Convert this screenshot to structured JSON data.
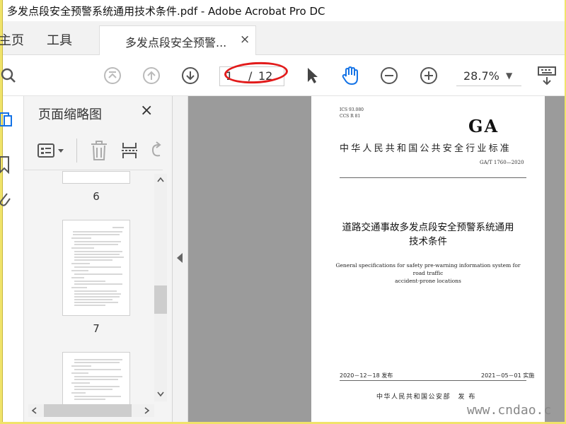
{
  "window": {
    "title": "多发点段安全预警系统通用技术条件.pdf - Adobe Acrobat Pro DC"
  },
  "menu": {
    "home": "主页",
    "tools": "工具"
  },
  "tab": {
    "label": "多发点段安全预警...",
    "close": "×"
  },
  "toolbar": {
    "page_current": "1",
    "page_sep": "/",
    "page_total": "12",
    "zoom": "28.7%",
    "zoom_arrow": "▼"
  },
  "thumbnails": {
    "title": "页面缩略图",
    "close": "×",
    "pages": [
      "6",
      "7"
    ]
  },
  "document": {
    "ics": "ICS 93.080",
    "ccs": "CCS R 81",
    "logo": "GA",
    "standard_name": "中华人民共和国公共安全行业标准",
    "code": "GA/T 1760—2020",
    "title_line1": "道路交通事故多发点段安全预警系统通用",
    "title_line2": "技术条件",
    "english_line1": "General specifications for safety pre-warning information system for road traffic",
    "english_line2": "accident-prone locations",
    "issue_date": "2020－12－18 发布",
    "effective_date": "2021－05－01 实施",
    "publisher": "中华人民共和国公安部　发 布"
  },
  "watermark": "www.cndao.c",
  "colors": {
    "accent": "#1473e6",
    "highlight": "#e21b1b",
    "doc_bg": "#9b9b9b"
  }
}
